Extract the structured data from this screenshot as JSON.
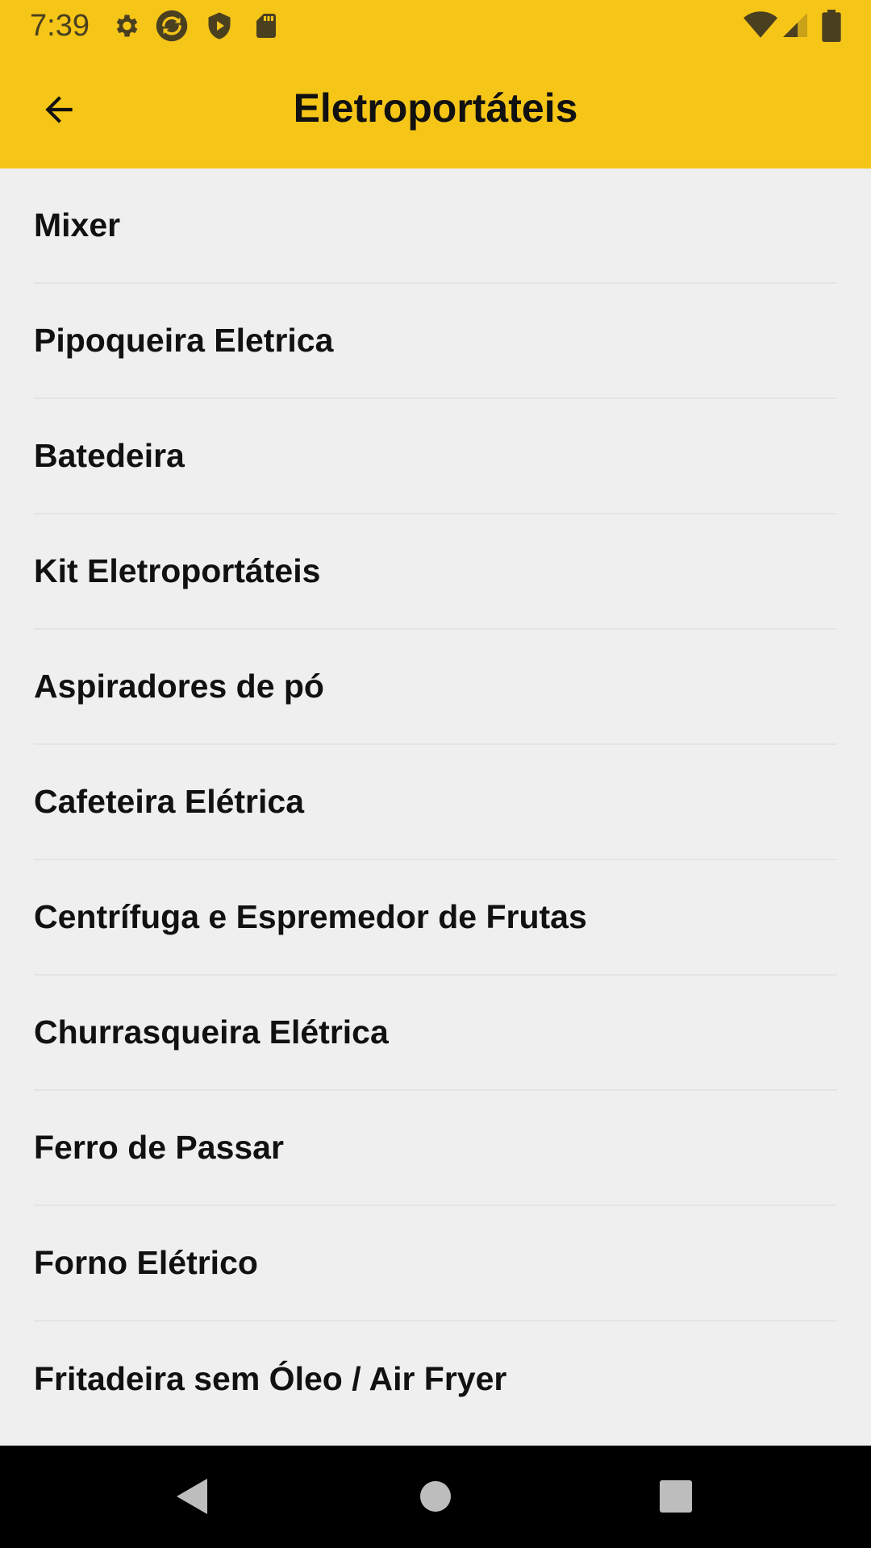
{
  "status_bar": {
    "time": "7:39",
    "left_icons": [
      "gear-icon",
      "sync-icon",
      "shield-play-icon",
      "sd-card-icon"
    ],
    "right_icons": [
      "wifi-icon",
      "signal-icon",
      "battery-icon"
    ]
  },
  "app_bar": {
    "title": "Eletroportáteis",
    "back_icon": "arrow-back-icon",
    "background": "#f5c518"
  },
  "list": {
    "items": [
      {
        "label": "Mixer"
      },
      {
        "label": "Pipoqueira Eletrica"
      },
      {
        "label": "Batedeira"
      },
      {
        "label": "Kit Eletroportáteis"
      },
      {
        "label": "Aspiradores de pó"
      },
      {
        "label": "Cafeteira Elétrica"
      },
      {
        "label": "Centrífuga e Espremedor de Frutas"
      },
      {
        "label": "Churrasqueira Elétrica"
      },
      {
        "label": "Ferro de Passar"
      },
      {
        "label": "Forno Elétrico"
      },
      {
        "label": "Fritadeira sem Óleo / Air Fryer"
      }
    ]
  },
  "nav_bar": {
    "buttons": [
      "nav-back-icon",
      "nav-home-icon",
      "nav-recents-icon"
    ]
  }
}
